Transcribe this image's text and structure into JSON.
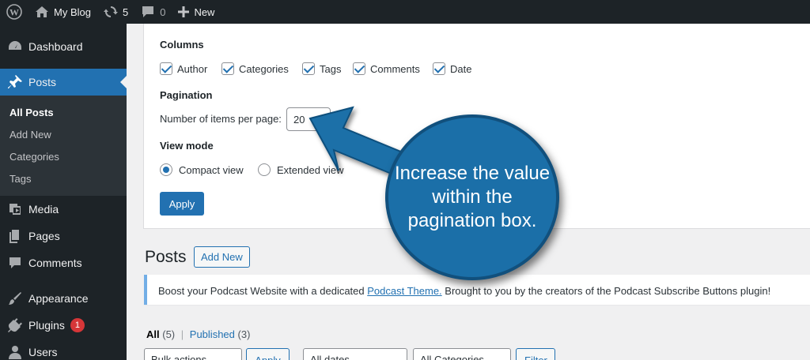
{
  "adminbar": {
    "site_name": "My Blog",
    "updates_count": "5",
    "comments_count": "0",
    "new_label": "New"
  },
  "sidebar": {
    "items": {
      "dashboard": "Dashboard",
      "posts": "Posts",
      "media": "Media",
      "pages": "Pages",
      "comments": "Comments",
      "appearance": "Appearance",
      "plugins": "Plugins",
      "users": "Users"
    },
    "plugins_badge": "1",
    "submenu": [
      "All Posts",
      "Add New",
      "Categories",
      "Tags"
    ]
  },
  "screen_options": {
    "columns_heading": "Columns",
    "columns": [
      "Author",
      "Categories",
      "Tags",
      "Comments",
      "Date"
    ],
    "pagination_heading": "Pagination",
    "items_per_page_label": "Number of items per page:",
    "items_per_page_value": "20",
    "view_mode_heading": "View mode",
    "view_modes": [
      "Compact view",
      "Extended view"
    ],
    "apply_label": "Apply"
  },
  "page": {
    "title": "Posts",
    "add_new_label": "Add New"
  },
  "notice": {
    "text_before": "Boost your Podcast Website with a dedicated ",
    "link_text": "Podcast Theme.",
    "text_after": " Brought to you by the creators of the Podcast Subscribe Buttons plugin!"
  },
  "filters": {
    "all_label": "All",
    "all_count": "(5)",
    "separator": "|",
    "published_label": "Published",
    "published_count": "(3)"
  },
  "tablenav": {
    "bulk_actions": "Bulk actions",
    "apply": "Apply",
    "all_dates": "All dates",
    "all_categories": "All Categories",
    "filter": "Filter"
  },
  "callout": {
    "text": "Increase the value within the pagination box."
  },
  "colors": {
    "admin_dark": "#1d2327",
    "accent_blue": "#2271b1",
    "callout_blue": "#1b6fa8",
    "badge_red": "#d63638"
  }
}
